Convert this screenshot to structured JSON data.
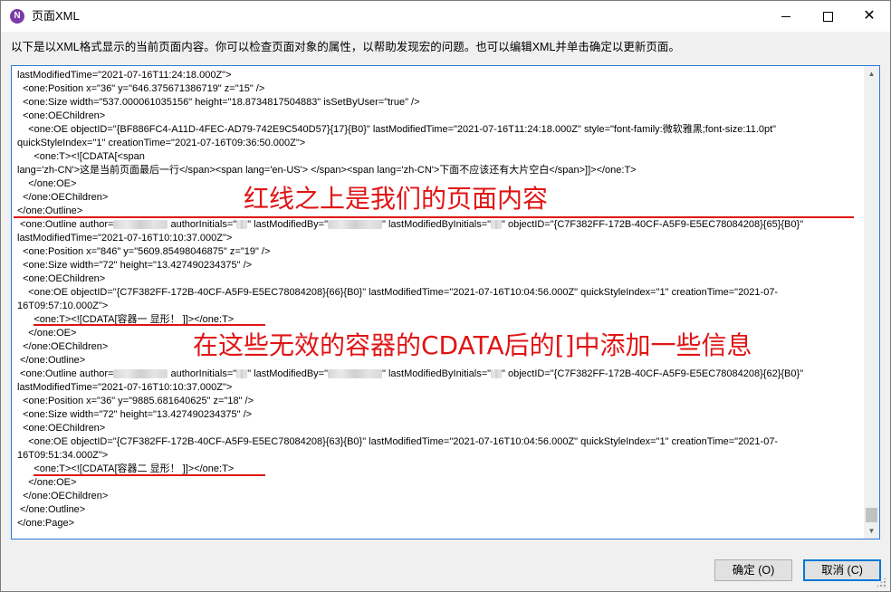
{
  "window": {
    "title": "页面XML",
    "icon_name": "app-icon",
    "icon_glyph": "N",
    "min_glyph": "",
    "close_glyph": "✕"
  },
  "description": "以下是以XML格式显示的当前页面内容。你可以检查页面对象的属性，以帮助发现宏的问题。也可以编辑XML并单击确定以更新页面。",
  "xml": {
    "lines": [
      {
        "text": "lastModifiedTime=\"2021-07-16T11:24:18.000Z\">"
      },
      {
        "text": "  <one:Position x=\"36\" y=\"646.375671386719\" z=\"15\" />"
      },
      {
        "text": "  <one:Size width=\"537.000061035156\" height=\"18.8734817504883\" isSetByUser=\"true\" />"
      },
      {
        "text": "  <one:OEChildren>"
      },
      {
        "text": "    <one:OE objectID=\"{BF886FC4-A11D-4FEC-AD79-742E9C540D57}{17}{B0}\" lastModifiedTime=\"2021-07-16T11:24:18.000Z\" style=\"font-family:微软雅黑;font-size:11.0pt\""
      },
      {
        "text": "quickStyleIndex=\"1\" creationTime=\"2021-07-16T09:36:50.000Z\">"
      },
      {
        "text": "      <one:T><![CDATA[<span"
      },
      {
        "text": "lang='zh-CN'>这是当前页面最后一行</span><span lang='en-US'> </span><span lang='zh-CN'>下面不应该还有大片空白</span>]]></one:T>"
      },
      {
        "text": "    </one:OE>"
      },
      {
        "text": "  </one:OEChildren>"
      },
      {
        "text": "</one:Outline>"
      },
      {
        "parts": [
          " <one:Outline author=",
          "",
          " authorInitials=\"",
          "",
          "\" lastModifiedBy=\"",
          "",
          "\" lastModifiedByInitials=\"",
          "",
          "\" objectID=\"{C7F382FF-172B-40CF-A5F9-E5EC78084208}{65}{B0}\""
        ]
      },
      {
        "text": "lastModifiedTime=\"2021-07-16T10:10:37.000Z\">"
      },
      {
        "text": "  <one:Position x=\"846\" y=\"5609.85498046875\" z=\"19\" />"
      },
      {
        "text": "  <one:Size width=\"72\" height=\"13.427490234375\" />"
      },
      {
        "text": "  <one:OEChildren>"
      },
      {
        "text": "    <one:OE objectID=\"{C7F382FF-172B-40CF-A5F9-E5EC78084208}{66}{B0}\" lastModifiedTime=\"2021-07-16T10:04:56.000Z\" quickStyleIndex=\"1\" creationTime=\"2021-07-"
      },
      {
        "text": "16T09:57:10.000Z\">"
      },
      {
        "text": "      <one:T><![CDATA[容器一 显形！ ]]></one:T>"
      },
      {
        "text": "    </one:OE>"
      },
      {
        "text": "  </one:OEChildren>"
      },
      {
        "text": " </one:Outline>"
      },
      {
        "parts": [
          " <one:Outline author=",
          "",
          " authorInitials=\"",
          "",
          "\" lastModifiedBy=\"",
          "",
          "\" lastModifiedByInitials=\"",
          "",
          "\" objectID=\"{C7F382FF-172B-40CF-A5F9-E5EC78084208}{62}{B0}\""
        ]
      },
      {
        "text": "lastModifiedTime=\"2021-07-16T10:10:37.000Z\">"
      },
      {
        "text": "  <one:Position x=\"36\" y=\"9885.681640625\" z=\"18\" />"
      },
      {
        "text": "  <one:Size width=\"72\" height=\"13.427490234375\" />"
      },
      {
        "text": "  <one:OEChildren>"
      },
      {
        "text": "    <one:OE objectID=\"{C7F382FF-172B-40CF-A5F9-E5EC78084208}{63}{B0}\" lastModifiedTime=\"2021-07-16T10:04:56.000Z\" quickStyleIndex=\"1\" creationTime=\"2021-07-"
      },
      {
        "text": "16T09:51:34.000Z\">"
      },
      {
        "text": "      <one:T><![CDATA[容器二 显形！ ]]></one:T>"
      },
      {
        "text": "    </one:OE>"
      },
      {
        "text": "  </one:OEChildren>"
      },
      {
        "text": " </one:Outline>"
      },
      {
        "text": "</one:Page>"
      }
    ]
  },
  "annotations": {
    "top": "红线之上是我们的页面内容",
    "middle": "在这些无效的容器的CDATA后的[]中添加一些信息"
  },
  "buttons": {
    "ok": "确定 (O)",
    "cancel": "取消 (C)"
  },
  "colors": {
    "annotation": "#e01515",
    "focus_border": "#2b79d7"
  }
}
